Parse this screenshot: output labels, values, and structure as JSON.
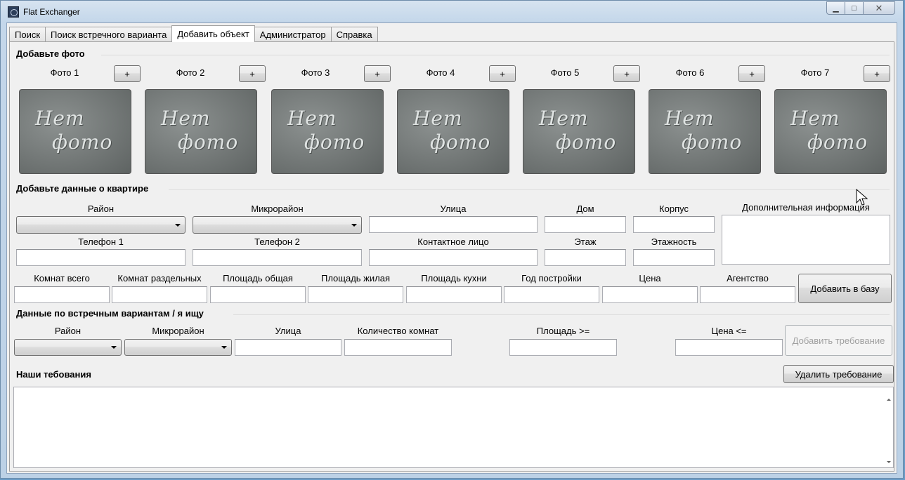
{
  "window": {
    "title": "Flat Exchanger",
    "min_label": "▁",
    "max_label": "□",
    "close_label": "✕"
  },
  "tabs": [
    {
      "label": "Поиск",
      "active": false
    },
    {
      "label": "Поиск встречного варианта",
      "active": false
    },
    {
      "label": "Добавить объект",
      "active": true
    },
    {
      "label": "Администратор",
      "active": false
    },
    {
      "label": "Справка",
      "active": false
    }
  ],
  "photos_section": {
    "title": "Добавьте фото",
    "add_label": "+",
    "no_photo_line1": "Нет",
    "no_photo_line2": "фото",
    "items": [
      "Фото 1",
      "Фото 2",
      "Фото 3",
      "Фото 4",
      "Фото 5",
      "Фото 6",
      "Фото 7"
    ]
  },
  "apartment_section": {
    "title": "Добавьте данные о квартире",
    "labels": {
      "district": "Район",
      "microdistrict": "Микрорайон",
      "street": "Улица",
      "house": "Дом",
      "building": "Корпус",
      "extra_info": "Дополнительная информация",
      "phone1": "Телефон 1",
      "phone2": "Телефон 2",
      "contact": "Контактное лицо",
      "floor": "Этаж",
      "floors_total": "Этажность",
      "rooms_total": "Комнат всего",
      "rooms_separate": "Комнат раздельных",
      "area_total": "Площадь общая",
      "area_living": "Площадь жилая",
      "area_kitchen": "Площадь кухни",
      "year_built": "Год постройки",
      "price": "Цена",
      "agency": "Агентство"
    },
    "add_button": "Добавить в базу"
  },
  "requirements_section": {
    "title": "Данные по встречным вариантам / я ищу",
    "labels": {
      "district": "Район",
      "microdistrict": "Микрорайон",
      "street": "Улица",
      "rooms_count": "Количество комнат",
      "area_min": "Площадь >=",
      "price_max": "Цена <="
    },
    "add_button": "Добавить требование"
  },
  "our_requirements": {
    "title": "Наши тебования",
    "delete_button": "Удалить требование"
  }
}
